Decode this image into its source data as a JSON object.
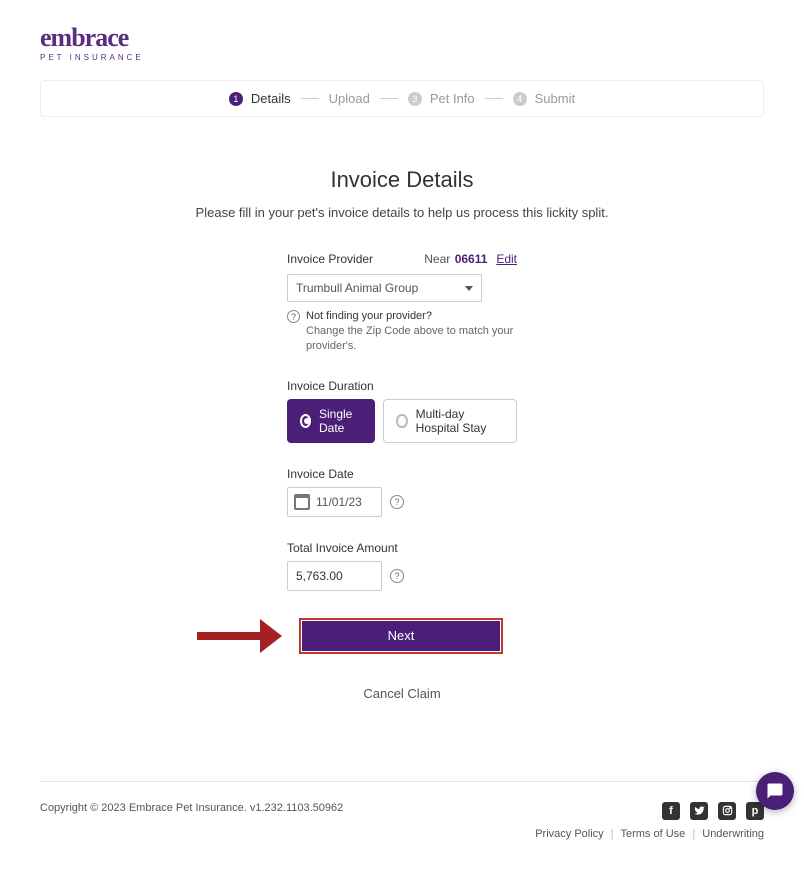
{
  "brand": {
    "name": "embrace",
    "tagline": "PET INSURANCE"
  },
  "stepper": {
    "steps": [
      "Details",
      "Upload",
      "Pet Info",
      "Submit"
    ],
    "active_index": 0
  },
  "page": {
    "title": "Invoice Details",
    "subtitle": "Please fill in your pet's invoice details to help us process this lickity split."
  },
  "provider": {
    "label": "Invoice Provider",
    "near_prefix": "Near",
    "zip": "06611",
    "edit": "Edit",
    "selected": "Trumbull Animal Group",
    "hint_title": "Not finding your provider?",
    "hint_body": "Change the Zip Code above to match your provider's."
  },
  "duration": {
    "label": "Invoice Duration",
    "options": [
      "Single Date",
      "Multi-day Hospital Stay"
    ],
    "selected_index": 0
  },
  "date": {
    "label": "Invoice Date",
    "value": "11/01/23"
  },
  "amount": {
    "label": "Total Invoice Amount",
    "value": "5,763.00"
  },
  "actions": {
    "next": "Next",
    "cancel": "Cancel Claim"
  },
  "footer": {
    "copyright": "Copyright © 2023   Embrace Pet Insurance. v1.232.1103.50962",
    "links": [
      "Privacy Policy",
      "Terms of Use",
      "Underwriting"
    ]
  }
}
